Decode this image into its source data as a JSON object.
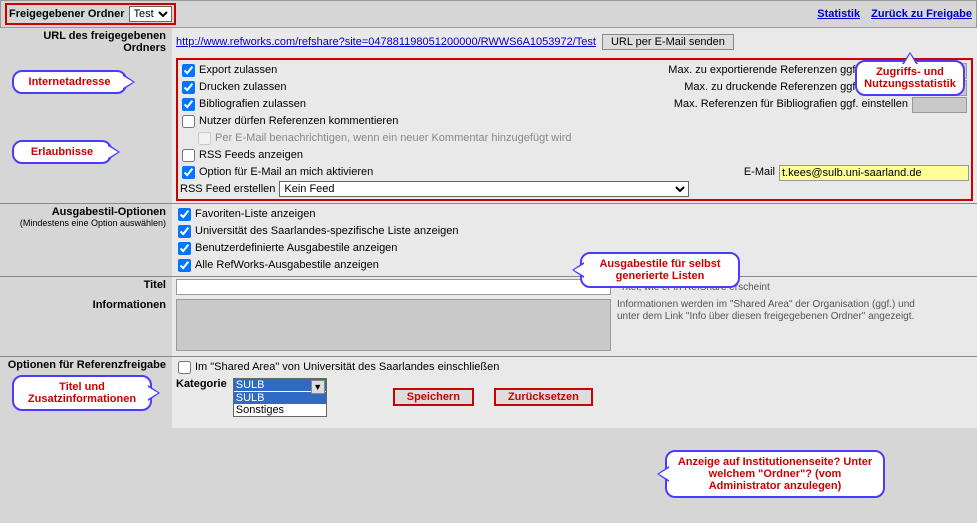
{
  "top": {
    "folder_label": "Freigegebener Ordner",
    "folder_value": "Test",
    "link_stats": "Statistik",
    "link_back": "Zurück zu Freigabe"
  },
  "url_section": {
    "label": "URL des freigegebenen Ordners",
    "url": "http://www.refworks.com/refshare?site=047881198051200000/RWWS6A1053972/Test",
    "send_btn": "URL per E-Mail senden"
  },
  "permissions": {
    "export": "Export zulassen",
    "export_max": "Max. zu exportierende Referenzen ggf. einstellen",
    "print": "Drucken zulassen",
    "print_max": "Max. zu druckende Referenzen ggf. einstellen",
    "biblio": "Bibliografien zulassen",
    "biblio_max": "Max. Referenzen für Bibliografien ggf. einstellen",
    "comment": "Nutzer dürfen Referenzen kommentieren",
    "email_notify": "Per E-Mail benachrichtigen, wenn ein neuer Kommentar hinzugefügt wird",
    "rss_show": "RSS Feeds anzeigen",
    "email_opt": "Option für E-Mail an mich aktivieren",
    "email_label": "E-Mail",
    "email_value": "t.kees@sulb.uni-saarland.de",
    "rss_create": "RSS Feed erstellen",
    "rss_value": "Kein Feed"
  },
  "styles": {
    "label": "Ausgabestil-Optionen",
    "sub": "(Mindestens eine Option auswählen)",
    "fav": "Favoriten-Liste anzeigen",
    "uni": "Universität des Saarlandes-spezifische Liste anzeigen",
    "custom": "Benutzerdefinierte Ausgabestile anzeigen",
    "all": "Alle RefWorks-Ausgabestile anzeigen"
  },
  "titel": {
    "label": "Titel",
    "hint": "Titel, wie er in RefShare erscheint"
  },
  "info": {
    "label": "Informationen",
    "hint": "Informationen werden im \"Shared Area\" der Organisation (ggf.) und unter dem Link \"Info über diesen freigegebenen Ordner\" angezeigt."
  },
  "ref_opts": {
    "label": "Optionen für Referenzfreigabe",
    "shared": "Im \"Shared Area\" von Universität des Saarlandes einschließen",
    "kategorie": "Kategorie",
    "kat_sel": "SULB",
    "kat_opts": [
      "SULB",
      "Sonstiges"
    ],
    "save": "Speichern",
    "reset": "Zurücksetzen"
  },
  "callouts": {
    "internet": "Internetadresse",
    "erlaubnisse": "Erlaubnisse",
    "zugriff": "Zugriffs- und Nutzungsstatistik",
    "ausgabe": "Ausgabestile für selbst generierte Listen",
    "titelinfo": "Titel und Zusatzinformationen",
    "anzeige": "Anzeige auf Institutionenseite? Unter welchem \"Ordner\"? (vom Administrator anzulegen)"
  }
}
